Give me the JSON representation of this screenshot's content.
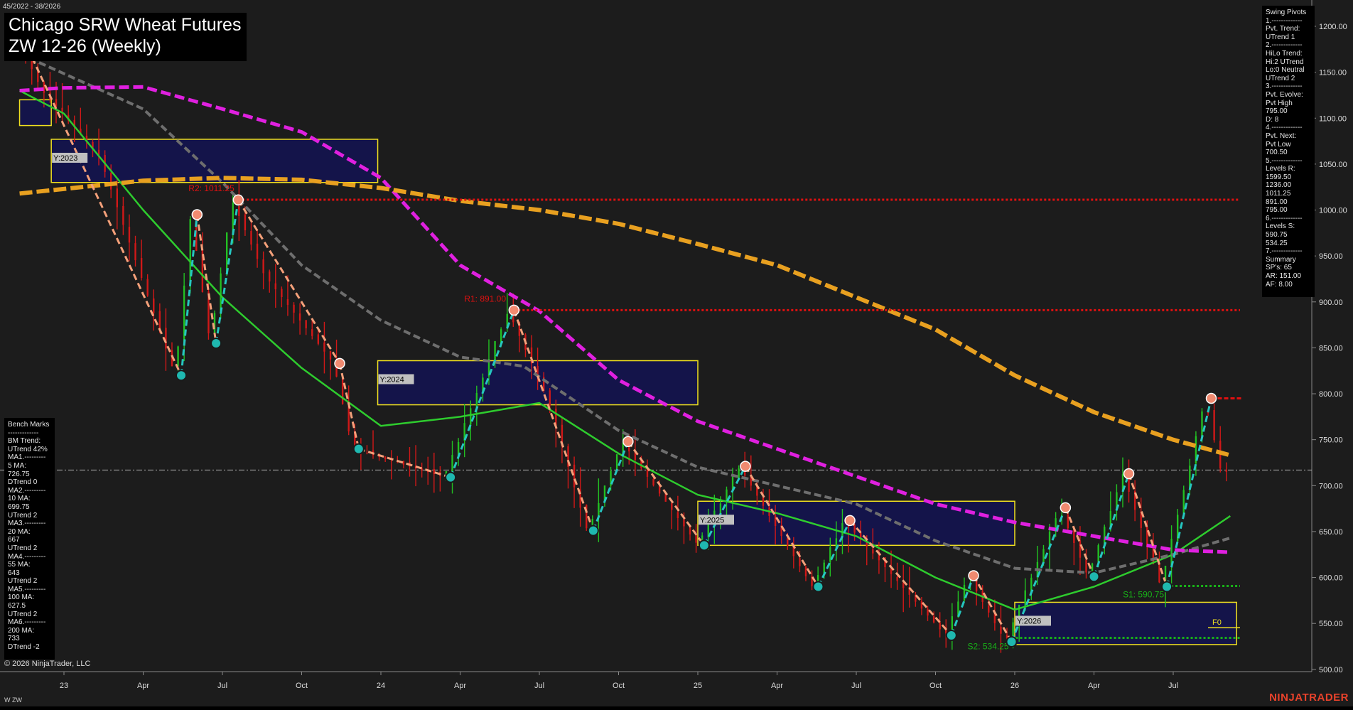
{
  "header": {
    "date_range": "45/2022 - 38/2026",
    "title": "Chicago SRW Wheat Futures",
    "subtitle": "ZW 12-26 (Weekly)"
  },
  "footer": {
    "copyright": "© 2026 NinjaTrader, LLC",
    "ticker": "W ZW",
    "brand": "NINJATRADER"
  },
  "colors": {
    "background": "#1c1c1c",
    "up_bar": "#22c022",
    "down_bar": "#d01818",
    "ma_green": "#2ecc2e",
    "ma_gray": "#6e6e6e",
    "ma_magenta": "#e020e0",
    "ma_orange": "#e8a020",
    "swing_up": "#26c6c0",
    "swing_down": "#f4a07a",
    "resistance": "#e01010",
    "support": "#18b018",
    "year_box_fill": "#141450",
    "year_box_border": "#f0e020"
  },
  "swing_pivots_panel": {
    "lines": [
      "Swing Pivots",
      "1.-------------",
      "Pvt. Trend:",
      "UTrend 1",
      "2.-------------",
      "HiLo Trend:",
      "Hi:2 UTrend",
      "Lo:0 Neutral",
      "UTrend 2",
      "3.-------------",
      "Pvt. Evolve:",
      "Pvt High",
      "795.00",
      "D: 8",
      "4.-------------",
      "Pvt. Next:",
      "Pvt Low",
      "700.50",
      "5.-------------",
      "Levels R:",
      "1599.50",
      "1236.00",
      "1011.25",
      "891.00",
      "795.00",
      "6.-------------",
      "Levels S:",
      "590.75",
      "534.25",
      "7.-------------",
      "Summary",
      "SP's: 65",
      "AR: 151.00",
      "AF: 8.00"
    ]
  },
  "bench_marks_panel": {
    "lines": [
      "Bench Marks",
      "-------------",
      "BM Trend:",
      "UTrend 42%",
      "MA1.---------",
      "5 MA:",
      "726.75",
      "DTrend 0",
      "MA2.---------",
      "10 MA:",
      "699.75",
      "UTrend 2",
      "MA3.---------",
      "20 MA:",
      "667",
      "UTrend 2",
      "MA4.---------",
      "55 MA:",
      "643",
      "UTrend 2",
      "MA5.---------",
      "100 MA:",
      "627.5",
      "UTrend 2",
      "MA6.---------",
      "200 MA:",
      "733",
      "DTrend -2"
    ]
  },
  "chart_data": {
    "type": "candlestick",
    "y_axis": {
      "ylim": [
        493,
        1227
      ],
      "ticks": [
        500,
        550,
        600,
        650,
        700,
        750,
        800,
        850,
        900,
        950,
        1000,
        1050,
        1100,
        1150,
        1200
      ],
      "tick_labels": [
        "500.00",
        "550.00",
        "600.00",
        "650.00",
        "700.00",
        "750.00",
        "800.00",
        "850.00",
        "900.00",
        "950.00",
        "1000.00",
        "1050.00",
        "1100.00",
        "1150.00",
        "1200.00"
      ]
    },
    "x_axis": {
      "xlim": [
        2022.86,
        2026.84
      ],
      "ticks": [
        2023.0,
        2023.25,
        2023.5,
        2023.75,
        2024.0,
        2024.25,
        2024.5,
        2024.75,
        2025.0,
        2025.25,
        2025.5,
        2025.75,
        2026.0,
        2026.25,
        2026.5
      ],
      "tick_labels": [
        "23",
        "Apr",
        "Jul",
        "Oct",
        "24",
        "Apr",
        "Jul",
        "Oct",
        "25",
        "Apr",
        "Jul",
        "Oct",
        "26",
        "Apr",
        "Jul"
      ]
    },
    "price_path": [
      [
        2022.86,
        1195
      ],
      [
        2022.95,
        1130
      ],
      [
        2023.13,
        1060
      ],
      [
        2023.37,
        820
      ],
      [
        2023.42,
        995
      ],
      [
        2023.48,
        855
      ],
      [
        2023.55,
        1011
      ],
      [
        2023.65,
        930
      ],
      [
        2023.87,
        833
      ],
      [
        2023.93,
        740
      ],
      [
        2024.22,
        709
      ],
      [
        2024.42,
        891
      ],
      [
        2024.55,
        790
      ],
      [
        2024.67,
        651
      ],
      [
        2024.78,
        748
      ],
      [
        2024.88,
        700
      ],
      [
        2025.02,
        635
      ],
      [
        2025.15,
        721
      ],
      [
        2025.38,
        590
      ],
      [
        2025.48,
        662
      ],
      [
        2025.8,
        537
      ],
      [
        2025.87,
        602
      ],
      [
        2025.99,
        530
      ],
      [
        2026.16,
        676
      ],
      [
        2026.25,
        601
      ],
      [
        2026.36,
        713
      ],
      [
        2026.48,
        590
      ],
      [
        2026.62,
        795
      ],
      [
        2026.67,
        715
      ]
    ],
    "swing_pivots": {
      "highs": [
        [
          2023.42,
          995
        ],
        [
          2023.55,
          1011
        ],
        [
          2023.87,
          833
        ],
        [
          2024.42,
          891
        ],
        [
          2024.78,
          748
        ],
        [
          2025.15,
          721
        ],
        [
          2025.48,
          662
        ],
        [
          2025.87,
          602
        ],
        [
          2026.16,
          676
        ],
        [
          2026.36,
          713
        ],
        [
          2026.62,
          795
        ]
      ],
      "lows": [
        [
          2023.37,
          820
        ],
        [
          2023.48,
          855
        ],
        [
          2023.93,
          740
        ],
        [
          2024.22,
          709
        ],
        [
          2024.67,
          651
        ],
        [
          2025.02,
          635
        ],
        [
          2025.38,
          590
        ],
        [
          2025.8,
          537
        ],
        [
          2025.99,
          530
        ],
        [
          2026.25,
          601
        ],
        [
          2026.48,
          590
        ]
      ]
    },
    "series": [
      {
        "id": "ma_green",
        "points": [
          [
            2022.86,
            1130
          ],
          [
            2023.0,
            1105
          ],
          [
            2023.25,
            1000
          ],
          [
            2023.5,
            905
          ],
          [
            2023.75,
            828
          ],
          [
            2024.0,
            765
          ],
          [
            2024.25,
            775
          ],
          [
            2024.5,
            790
          ],
          [
            2024.75,
            735
          ],
          [
            2025.0,
            690
          ],
          [
            2025.25,
            670
          ],
          [
            2025.5,
            645
          ],
          [
            2025.75,
            600
          ],
          [
            2026.0,
            565
          ],
          [
            2026.25,
            590
          ],
          [
            2026.5,
            625
          ],
          [
            2026.68,
            667
          ]
        ]
      },
      {
        "id": "ma_gray",
        "points": [
          [
            2022.86,
            1170
          ],
          [
            2023.25,
            1110
          ],
          [
            2023.5,
            1030
          ],
          [
            2023.75,
            940
          ],
          [
            2024.0,
            880
          ],
          [
            2024.25,
            840
          ],
          [
            2024.45,
            830
          ],
          [
            2024.75,
            760
          ],
          [
            2025.0,
            720
          ],
          [
            2025.5,
            680
          ],
          [
            2025.75,
            640
          ],
          [
            2026.0,
            610
          ],
          [
            2026.25,
            605
          ],
          [
            2026.5,
            625
          ],
          [
            2026.68,
            643
          ]
        ]
      },
      {
        "id": "ma_magenta",
        "points": [
          [
            2022.86,
            1130
          ],
          [
            2023.0,
            1133
          ],
          [
            2023.25,
            1134
          ],
          [
            2023.5,
            1110
          ],
          [
            2023.75,
            1085
          ],
          [
            2024.0,
            1035
          ],
          [
            2024.25,
            940
          ],
          [
            2024.5,
            890
          ],
          [
            2024.75,
            815
          ],
          [
            2025.0,
            770
          ],
          [
            2025.25,
            740
          ],
          [
            2025.5,
            710
          ],
          [
            2025.75,
            680
          ],
          [
            2026.0,
            660
          ],
          [
            2026.25,
            645
          ],
          [
            2026.5,
            630
          ],
          [
            2026.68,
            627.5
          ]
        ]
      },
      {
        "id": "ma_orange",
        "points": [
          [
            2022.86,
            1018
          ],
          [
            2023.25,
            1032
          ],
          [
            2023.5,
            1035
          ],
          [
            2023.75,
            1033
          ],
          [
            2024.0,
            1024
          ],
          [
            2024.25,
            1010
          ],
          [
            2024.5,
            1000
          ],
          [
            2024.75,
            985
          ],
          [
            2025.0,
            963
          ],
          [
            2025.25,
            940
          ],
          [
            2025.5,
            905
          ],
          [
            2025.75,
            870
          ],
          [
            2026.0,
            820
          ],
          [
            2026.25,
            780
          ],
          [
            2026.5,
            750
          ],
          [
            2026.68,
            733
          ]
        ]
      }
    ],
    "resistance_levels": [
      {
        "label": "R2: 1011.25",
        "value": 1011.25,
        "x_start": 2023.55
      },
      {
        "label": "R1: 891.00",
        "value": 891.0,
        "x_start": 2024.42
      }
    ],
    "support_levels": [
      {
        "label": "S1: 590.75",
        "value": 590.75,
        "x_start": 2026.48
      },
      {
        "label": "S2: 534.25",
        "value": 534.25,
        "x_start": 2025.99
      }
    ],
    "current_price_line": 717,
    "last_pivot_high": 795,
    "yearly_boxes": [
      {
        "label": "Y:2023",
        "x0": 2022.86,
        "x1": 2022.96,
        "y0": 1092,
        "y1": 1120
      },
      {
        "label": "Y:2023",
        "x0": 2022.96,
        "x1": 2023.99,
        "y0": 1030,
        "y1": 1077
      },
      {
        "label": "Y:2024",
        "x0": 2023.99,
        "x1": 2025.0,
        "y0": 788,
        "y1": 836
      },
      {
        "label": "Y:2025",
        "x0": 2025.0,
        "x1": 2026.0,
        "y0": 635,
        "y1": 683
      },
      {
        "label": "Y:2026",
        "x0": 2026.0,
        "x1": 2026.7,
        "y0": 527,
        "y1": 573
      }
    ],
    "f0_label": "F0",
    "f0_value": 550
  }
}
